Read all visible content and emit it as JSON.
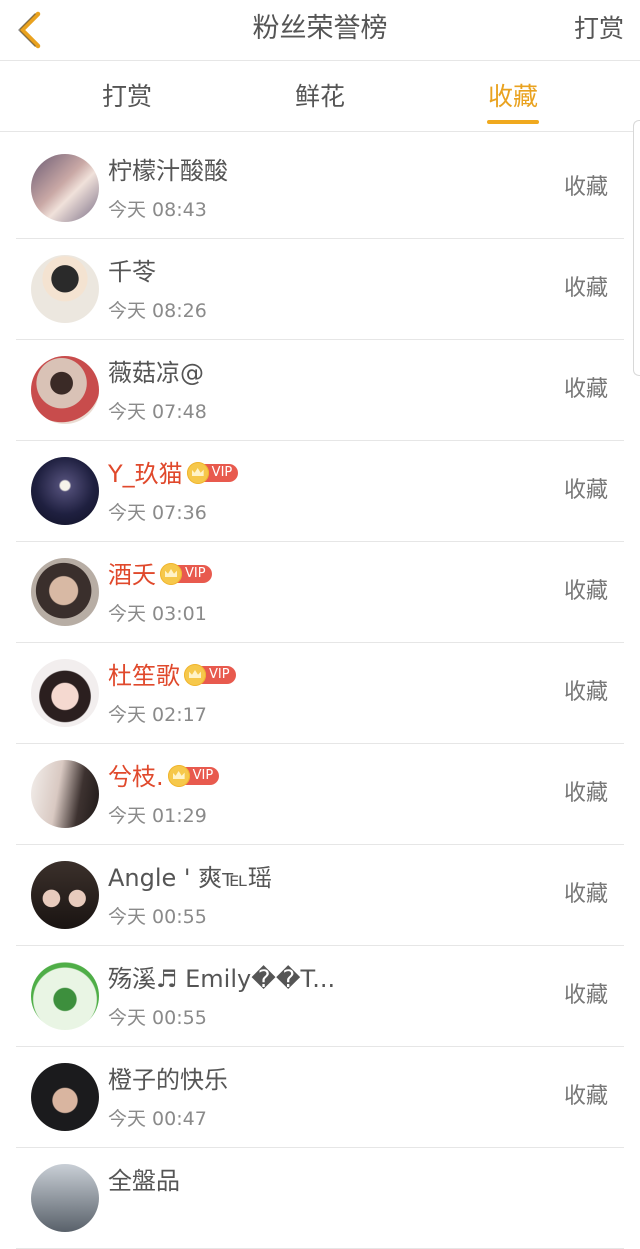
{
  "header": {
    "title": "粉丝荣誉榜",
    "right_label": "打赏"
  },
  "tabs": [
    {
      "label": "打赏",
      "active": false
    },
    {
      "label": "鲜花",
      "active": false
    },
    {
      "label": "收藏",
      "active": true
    }
  ],
  "colors": {
    "accent": "#f0a91e",
    "vip_name": "#e0492c",
    "vip_badge": "#e85a4e"
  },
  "rows": [
    {
      "name": "柠檬汁酸酸",
      "time": "今天 08:43",
      "action": "收藏",
      "vip": false
    },
    {
      "name": "千苓",
      "time": "今天 08:26",
      "action": "收藏",
      "vip": false
    },
    {
      "name": "薇菇凉@",
      "time": "今天 07:48",
      "action": "收藏",
      "vip": false
    },
    {
      "name": "Y_玖猫",
      "time": "今天 07:36",
      "action": "收藏",
      "vip": true,
      "badge": "VIP"
    },
    {
      "name": "酒夭",
      "time": "今天 03:01",
      "action": "收藏",
      "vip": true,
      "badge": "VIP"
    },
    {
      "name": "杜笙歌",
      "time": "今天 02:17",
      "action": "收藏",
      "vip": true,
      "badge": "VIP"
    },
    {
      "name": "兮枝.",
      "time": "今天 01:29",
      "action": "收藏",
      "vip": true,
      "badge": "VIP"
    },
    {
      "name": "Angle ' 爽℡瑶",
      "time": "今天 00:55",
      "action": "收藏",
      "vip": false
    },
    {
      "name": "殇溪♬ Emily��T...",
      "time": "今天 00:55",
      "action": "收藏",
      "vip": false
    },
    {
      "name": "橙子的快乐",
      "time": "今天 00:47",
      "action": "收藏",
      "vip": false
    },
    {
      "name": "全盤品",
      "time": "",
      "action": "",
      "vip": false
    }
  ]
}
